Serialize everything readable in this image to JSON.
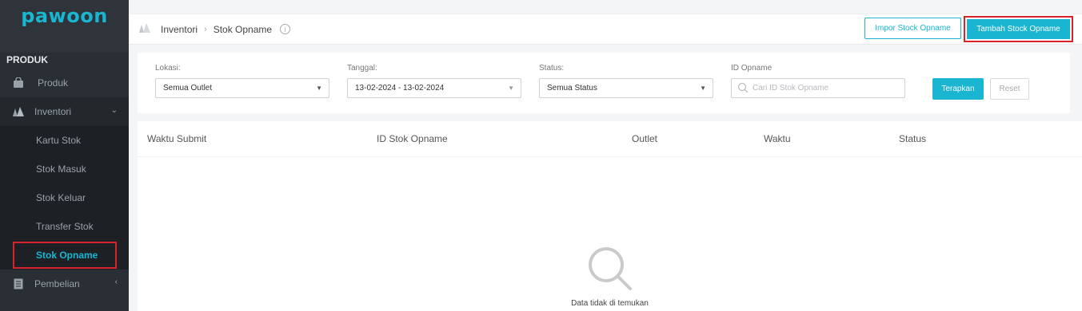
{
  "app": {
    "logo_text": "pawoon"
  },
  "sidebar": {
    "section_title": "PRODUK",
    "items": [
      {
        "label": "Produk",
        "icon": "bag-icon"
      },
      {
        "label": "Inventori",
        "icon": "boxes-icon",
        "expanded": true
      }
    ],
    "sub_items": [
      {
        "label": "Kartu Stok"
      },
      {
        "label": "Stok Masuk"
      },
      {
        "label": "Stok Keluar"
      },
      {
        "label": "Transfer Stok"
      },
      {
        "label": "Stok Opname",
        "active": true
      }
    ],
    "next_item": {
      "label": "Pembelian",
      "icon": "document-icon"
    }
  },
  "header": {
    "breadcrumb": [
      "Inventori",
      "Stok Opname"
    ],
    "import_button": "Impor Stock Opname",
    "add_button": "Tambah Stock Opname"
  },
  "filters": {
    "location": {
      "label": "Lokasi:",
      "value": "Semua Outlet"
    },
    "date": {
      "label": "Tanggal:",
      "value": "13-02-2024 - 13-02-2024"
    },
    "status": {
      "label": "Status:",
      "value": "Semua Status"
    },
    "opname_id": {
      "label": "ID Opname",
      "placeholder": "Cari ID Stok Opname"
    },
    "apply_button": "Terapkan",
    "reset_button": "Reset"
  },
  "table": {
    "columns": [
      "Waktu Submit",
      "ID Stok Opname",
      "Outlet",
      "Waktu",
      "Status"
    ],
    "rows": [],
    "empty_text": "Data tidak di temukan"
  },
  "colors": {
    "accent": "#19b5d1",
    "highlight": "#d9222a",
    "sidebar": "#2a2f35"
  }
}
